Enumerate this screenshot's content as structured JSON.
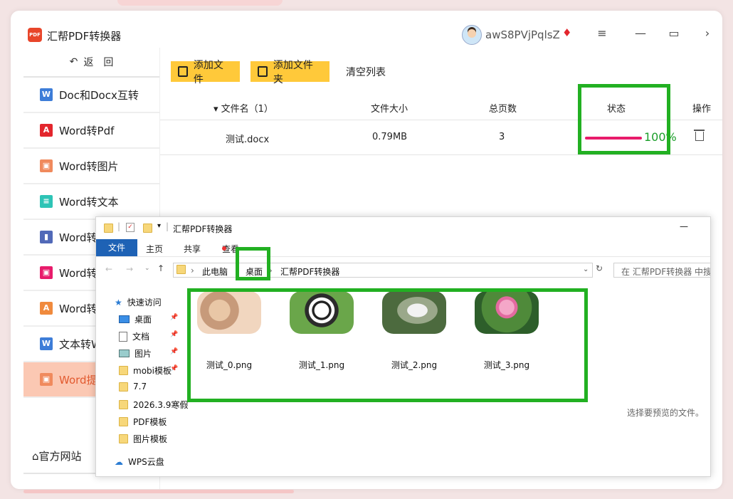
{
  "app": {
    "logo_text": "PDF",
    "title": "汇帮PDF转换器",
    "username": "awS8PVjPqlsZ",
    "vip_icon": "diamond-icon",
    "menu_glyph": "≡",
    "minimize_glyph": "—",
    "maximize_glyph": "▭",
    "more_glyph": "›"
  },
  "sidebar": {
    "back_label": "返　回",
    "items": [
      {
        "label": "Doc和Docx互转",
        "icon": "word-doc-icon",
        "color": "#3d7dd8",
        "glyph": "W"
      },
      {
        "label": "Word转Pdf",
        "icon": "pdf-icon",
        "color": "#e3262d",
        "glyph": "A"
      },
      {
        "label": "Word转图片",
        "icon": "image-icon",
        "color": "#f08a5d",
        "glyph": "▣"
      },
      {
        "label": "Word转文本",
        "icon": "text-file-icon",
        "color": "#2ec4b6",
        "glyph": "≡"
      },
      {
        "label": "Word转",
        "icon": "doc-icon",
        "color": "#5169b8",
        "glyph": "▮"
      },
      {
        "label": "Word转",
        "icon": "image-icon",
        "color": "#e81b6b",
        "glyph": "▣"
      },
      {
        "label": "Word转",
        "icon": "pdf-icon",
        "color": "#f08a3d",
        "glyph": "A"
      },
      {
        "label": "文本转W",
        "icon": "word-icon",
        "color": "#3d7dd8",
        "glyph": "W"
      },
      {
        "label": "Word提",
        "icon": "image-icon",
        "color": "#f08a5d",
        "glyph": "▣"
      }
    ],
    "official_site": "官方网站"
  },
  "toolbar": {
    "add_file": "添加文件",
    "add_folder": "添加文件夹",
    "clear_list": "清空列表"
  },
  "table": {
    "columns": {
      "filename": "▾ 文件名（1）",
      "size": "文件大小",
      "pages": "总页数",
      "status": "状态",
      "action": "操作"
    },
    "rows": [
      {
        "filename": "测试.docx",
        "size": "0.79MB",
        "pages": "3",
        "progress_text": "100%",
        "progress": 1.0
      }
    ]
  },
  "explorer": {
    "title": "汇帮PDF转换器",
    "minimize_glyph": "—",
    "ribbon": {
      "file": "文件",
      "home": "主页",
      "share": "共享",
      "view": "查看"
    },
    "breadcrumb": [
      "此电脑",
      "桌面",
      "汇帮PDF转换器"
    ],
    "search_placeholder": "在 汇帮PDF转换器 中搜索",
    "nav": [
      {
        "label": "快速访问",
        "icon": "star-icon"
      },
      {
        "label": "桌面",
        "icon": "desktop-icon",
        "pinned": true
      },
      {
        "label": "文档",
        "icon": "documents-icon",
        "pinned": true
      },
      {
        "label": "图片",
        "icon": "pictures-icon",
        "pinned": true
      },
      {
        "label": "mobi模板",
        "icon": "folder-icon",
        "pinned": true
      },
      {
        "label": "7.7",
        "icon": "folder-icon"
      },
      {
        "label": "2026.3.9寒假",
        "icon": "folder-icon"
      },
      {
        "label": "PDF模板",
        "icon": "folder-icon"
      },
      {
        "label": "图片模板",
        "icon": "folder-icon"
      },
      {
        "label": "WPS云盘",
        "icon": "cloud-icon"
      }
    ],
    "files": [
      {
        "name": "测试_0.png",
        "icon": "image-thumbnail-person"
      },
      {
        "name": "测试_1.png",
        "icon": "image-thumbnail-panda"
      },
      {
        "name": "测试_2.png",
        "icon": "image-thumbnail-rabbit"
      },
      {
        "name": "测试_3.png",
        "icon": "image-thumbnail-lotus"
      }
    ],
    "preview_hint": "选择要预览的文件。"
  },
  "colors": {
    "accent": "#ffc93a",
    "active_bg": "#fbc8b3",
    "highlight": "#22b022",
    "progress": "#e81b6b",
    "progress_text": "#1b9e2a",
    "explorer_blue": "#1e62b5"
  }
}
